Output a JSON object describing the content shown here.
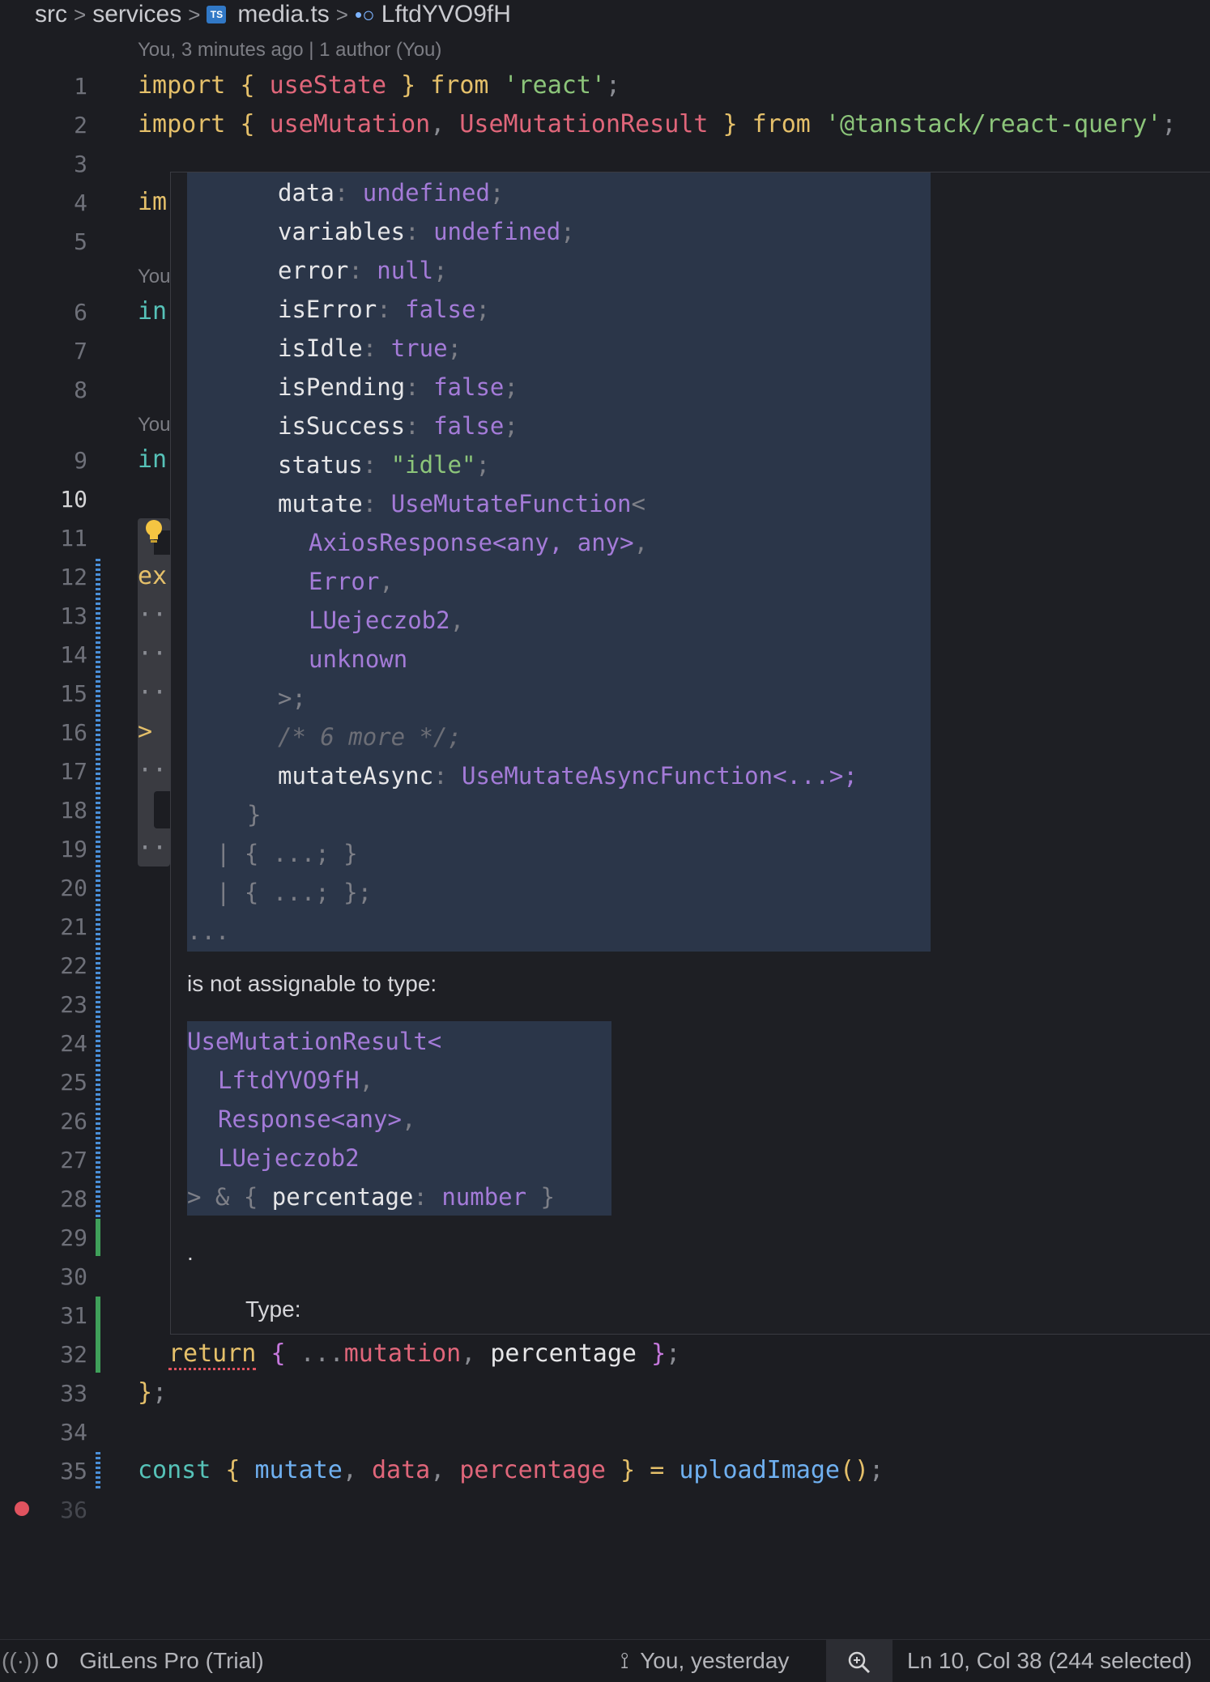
{
  "breadcrumb": {
    "parts": [
      "src",
      "services",
      "media.ts",
      "LftdYVO9fH"
    ],
    "file_badge": "TS"
  },
  "blame": {
    "header": "You, 3 minutes ago | 1 author (You)",
    "line6": "You",
    "line9": "You"
  },
  "editor": {
    "line_numbers": [
      "1",
      "2",
      "3",
      "4",
      "5",
      "6",
      "7",
      "8",
      "9",
      "10",
      "11",
      "12",
      "13",
      "14",
      "15",
      "16",
      "17",
      "18",
      "19",
      "20",
      "21",
      "22",
      "23",
      "24",
      "25",
      "26",
      "27",
      "28",
      "29",
      "30",
      "31",
      "32",
      "33",
      "34",
      "35",
      "36"
    ],
    "active_line": "10",
    "line1": {
      "kw1": "import",
      "b1": "{",
      "id": "useState",
      "b2": "}",
      "kw2": "from",
      "str": "'react'",
      "semi": ";"
    },
    "line2": {
      "kw1": "import",
      "b1": "{",
      "id1": "useMutation",
      "comma": ",",
      "id2": "UseMutationResult",
      "b2": "}",
      "kw2": "from",
      "str": "'@tanstack/react-query'",
      "semi": ";"
    },
    "line4": "im",
    "line6": "in",
    "line9": "in",
    "line12": "ex",
    "line13": "··",
    "line14": "··",
    "line15": "··",
    "line16": ">",
    "line17": "··",
    "line19": "··",
    "line32": {
      "kw": "return",
      "b1": "{",
      "spread": "...",
      "id1": "mutation",
      "comma": ",",
      "id2": "percentage",
      "b2": "}",
      "semi": ";"
    },
    "line33": {
      "b": "}",
      "semi": ";"
    },
    "line35": {
      "kw": "const",
      "b1": "{",
      "id1": "mutate",
      "c1": ",",
      "id2": "data",
      "c2": ",",
      "id3": "percentage",
      "b2": "}",
      "eq": "=",
      "fn": "uploadImage",
      "parens": "()",
      "semi": ";"
    }
  },
  "hover": {
    "props": [
      {
        "key": "data",
        "value": "undefined"
      },
      {
        "key": "variables",
        "value": "undefined"
      },
      {
        "key": "error",
        "value": "null"
      },
      {
        "key": "isError",
        "value": "false"
      },
      {
        "key": "isIdle",
        "value": "true"
      },
      {
        "key": "isPending",
        "value": "false"
      },
      {
        "key": "isSuccess",
        "value": "false"
      },
      {
        "key": "status",
        "value": "\"idle\""
      }
    ],
    "mutate_key": "mutate",
    "mutate_type": "UseMutateFunction",
    "mutate_args": [
      "AxiosResponse<any, any>",
      "Error",
      "LUejeczob2",
      "unknown"
    ],
    "mutate_close": ">;",
    "more_comment": "/* 6 more */;",
    "mutateAsync_key": "mutateAsync",
    "mutateAsync_type": "UseMutateAsyncFunction<...>;",
    "close_brace": "}",
    "union1": "| { ...; }",
    "union2": "| { ...; };",
    "ellipsis": "...",
    "not_assignable": "is not assignable to type:",
    "target_type": "UseMutationResult<",
    "target_args": [
      "LftdYVO9fH",
      "Response<any>",
      "LUejeczob2"
    ],
    "target_close_pre": "> & {",
    "target_close_key": "percentage",
    "target_close_type": "number",
    "target_close_post": "}",
    "period": ".",
    "type_label": "Type:"
  },
  "statusbar": {
    "ports": "0",
    "gitlens": "GitLens Pro (Trial)",
    "blame": "You, yesterday",
    "position": "Ln 10, Col 38 (244 selected)"
  }
}
